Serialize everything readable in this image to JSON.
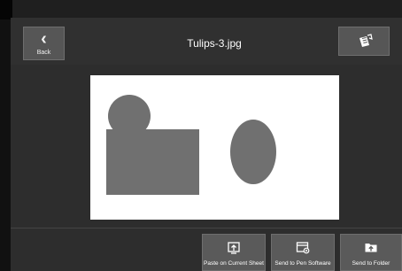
{
  "header": {
    "back_label": "Back",
    "title": "Tulips-3.jpg",
    "back_icon": "chevron-left-icon",
    "share_icon": "document-share-icon"
  },
  "toolbar": {
    "paste_label": "Paste on Current Sheet",
    "paste_icon": "paste-sheet-icon",
    "send_pen_label": "Send to Pen Software",
    "send_pen_icon": "send-pen-software-icon",
    "send_folder_label": "Send to Folder",
    "send_folder_icon": "send-folder-icon"
  },
  "colors": {
    "background": "#2d2d2d",
    "button": "#565656",
    "shape": "#707070",
    "text": "#ffffff"
  }
}
